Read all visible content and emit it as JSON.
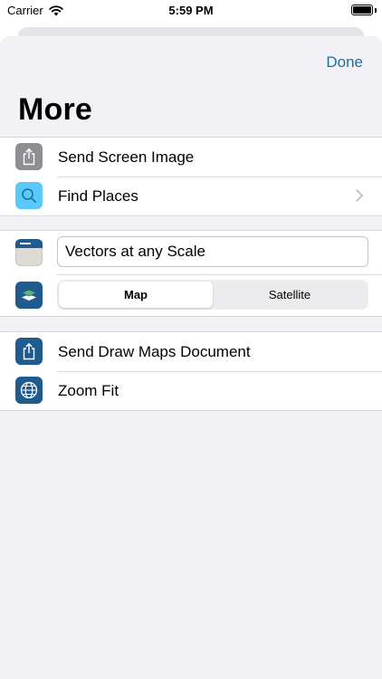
{
  "status_bar": {
    "carrier": "Carrier",
    "time": "5:59 PM",
    "battery_level": 1.0
  },
  "sheet": {
    "done_label": "Done",
    "title": "More"
  },
  "group1": {
    "items": [
      {
        "label": "Send Screen Image",
        "icon": "share-icon"
      },
      {
        "label": "Find Places",
        "icon": "magnifier-icon"
      }
    ]
  },
  "group2": {
    "map_name_value": "Vectors at any Scale",
    "map_type_options": [
      "Map",
      "Satellite"
    ],
    "map_type_selected": "Map"
  },
  "group3": {
    "items": [
      {
        "label": "Send Draw Maps Document",
        "icon": "share-icon"
      },
      {
        "label": "Zoom Fit",
        "icon": "globe-icon"
      }
    ]
  },
  "colors": {
    "accent": "#1f6e9a",
    "icon_blue": "#1f5b8f",
    "icon_gray": "#8e8e93",
    "icon_light_blue": "#5ac8fa",
    "background": "#f1f1f6"
  }
}
